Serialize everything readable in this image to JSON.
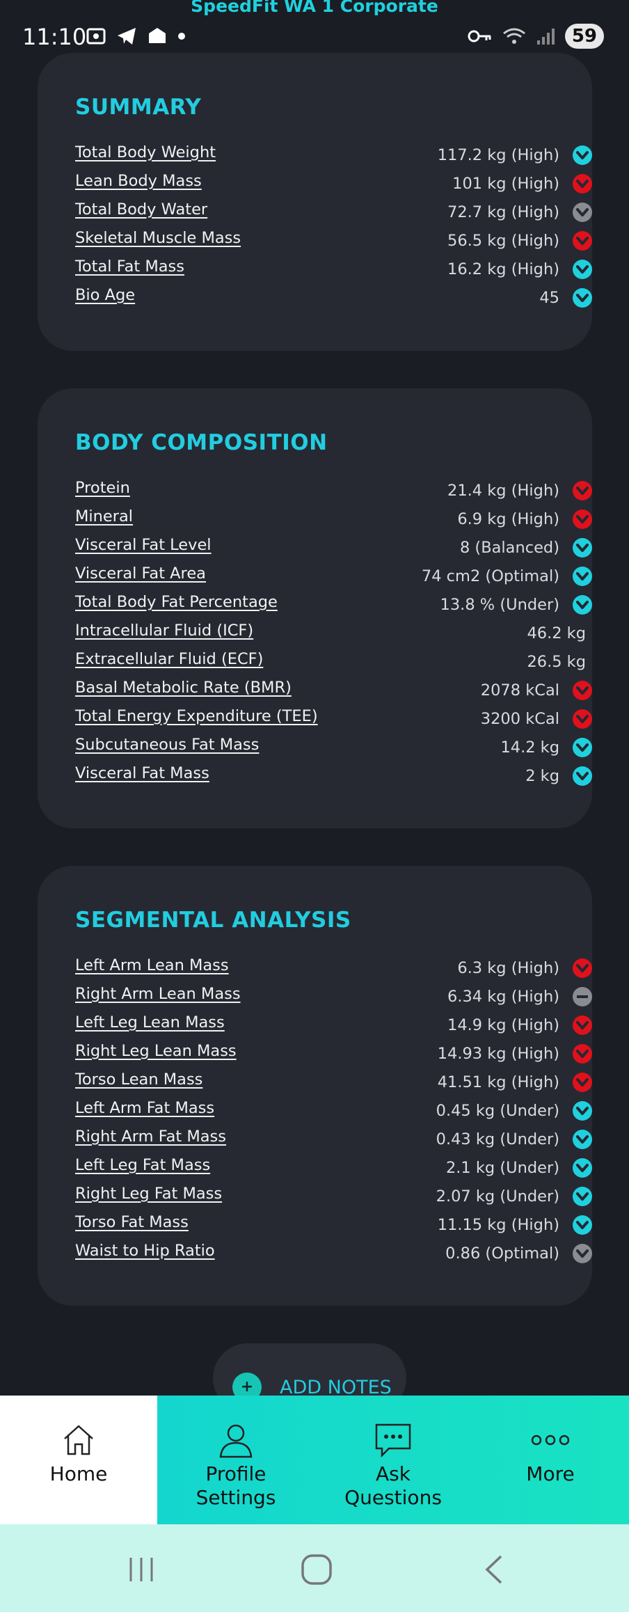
{
  "status_bar": {
    "app_title": "SpeedFit WA 1 Corporate",
    "time": "11:10",
    "battery": "59"
  },
  "colors": {
    "accent": "#22cde0",
    "card": "#262932",
    "background": "#1b1d24",
    "high": "#e0111c",
    "ok": "#1fd1de",
    "neutral": "#8a8c91",
    "nav": "#14d8cc"
  },
  "summary": {
    "title": "SUMMARY",
    "rows": [
      {
        "label": "Total Body Weight",
        "value": "117.2 kg (High)",
        "indicator": "cyan-down"
      },
      {
        "label": "Lean Body Mass",
        "value": "101 kg (High)",
        "indicator": "red-down"
      },
      {
        "label": "Total Body Water",
        "value": "72.7 kg (High)",
        "indicator": "gray-down"
      },
      {
        "label": "Skeletal Muscle Mass",
        "value": "56.5 kg (High)",
        "indicator": "red-down"
      },
      {
        "label": "Total Fat Mass",
        "value": "16.2 kg (High)",
        "indicator": "cyan-down"
      },
      {
        "label": "Bio Age",
        "value": "45",
        "indicator": "cyan-down"
      }
    ]
  },
  "body_composition": {
    "title": "BODY COMPOSITION",
    "rows": [
      {
        "label": "Protein",
        "value": "21.4 kg (High)",
        "indicator": "red-down"
      },
      {
        "label": "Mineral",
        "value": "6.9 kg (High)",
        "indicator": "red-down"
      },
      {
        "label": "Visceral Fat Level",
        "value": "8 (Balanced)",
        "indicator": "cyan-down"
      },
      {
        "label": "Visceral Fat Area",
        "value": "74 cm2 (Optimal)",
        "indicator": "cyan-down"
      },
      {
        "label": "Total Body Fat Percentage",
        "value": "13.8 % (Under)",
        "indicator": "cyan-down"
      },
      {
        "label": "Intracellular Fluid (ICF)",
        "value": "46.2 kg",
        "indicator": "none"
      },
      {
        "label": "Extracellular Fluid (ECF)",
        "value": "26.5 kg",
        "indicator": "none"
      },
      {
        "label": "Basal Metabolic Rate (BMR)",
        "value": "2078 kCal",
        "indicator": "red-down"
      },
      {
        "label": "Total Energy Expenditure (TEE)",
        "value": "3200 kCal",
        "indicator": "red-down"
      },
      {
        "label": "Subcutaneous Fat Mass",
        "value": "14.2 kg",
        "indicator": "cyan-down"
      },
      {
        "label": "Visceral Fat Mass",
        "value": "2 kg",
        "indicator": "cyan-down"
      }
    ]
  },
  "segmental_analysis": {
    "title": "SEGMENTAL ANALYSIS",
    "rows": [
      {
        "label": "Left Arm Lean Mass",
        "value": "6.3 kg (High)",
        "indicator": "red-down"
      },
      {
        "label": "Right Arm Lean Mass",
        "value": "6.34 kg (High)",
        "indicator": "gray-minus"
      },
      {
        "label": "Left Leg Lean Mass",
        "value": "14.9 kg (High)",
        "indicator": "red-down"
      },
      {
        "label": "Right Leg Lean Mass",
        "value": "14.93 kg (High)",
        "indicator": "red-down"
      },
      {
        "label": "Torso Lean Mass",
        "value": "41.51 kg (High)",
        "indicator": "red-down"
      },
      {
        "label": "Left Arm Fat Mass",
        "value": "0.45 kg (Under)",
        "indicator": "cyan-down"
      },
      {
        "label": "Right Arm Fat Mass",
        "value": "0.43 kg (Under)",
        "indicator": "cyan-down"
      },
      {
        "label": "Left Leg Fat Mass",
        "value": "2.1 kg (Under)",
        "indicator": "cyan-down"
      },
      {
        "label": "Right Leg Fat Mass",
        "value": "2.07 kg (Under)",
        "indicator": "cyan-down"
      },
      {
        "label": "Torso Fat Mass",
        "value": "11.15 kg (High)",
        "indicator": "cyan-down"
      },
      {
        "label": "Waist to Hip Ratio",
        "value": "0.86 (Optimal)",
        "indicator": "gray-down"
      }
    ]
  },
  "add_notes": {
    "label": "ADD NOTES",
    "icon": "plus-icon"
  },
  "bottom_nav": [
    {
      "label": "Home",
      "icon": "home-icon",
      "active": true
    },
    {
      "label": "Profile\nSettings",
      "icon": "profile-icon",
      "active": false
    },
    {
      "label": "Ask\nQuestions",
      "icon": "chat-icon",
      "active": false
    },
    {
      "label": "More",
      "icon": "more-icon",
      "active": false
    }
  ]
}
